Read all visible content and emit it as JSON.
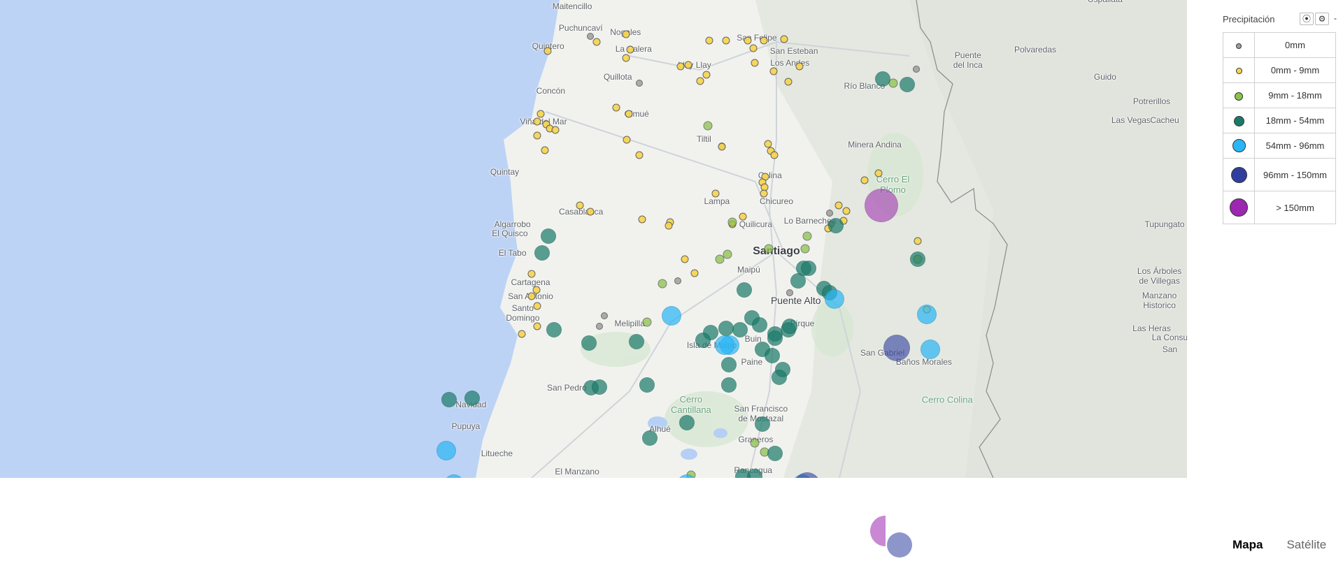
{
  "legend": {
    "title": "Precipitación",
    "controls": {
      "locate_icon": "⦿",
      "settings_icon": "⚙",
      "collapse_label": "-"
    },
    "items": [
      {
        "label": "0mm",
        "color": "#9e9e9e",
        "size": 8
      },
      {
        "label": "0mm - 9mm",
        "color": "#f7d44c",
        "size": 9
      },
      {
        "label": "9mm - 18mm",
        "color": "#8bc34a",
        "size": 12
      },
      {
        "label": "18mm - 54mm",
        "color": "#1a7a6a",
        "size": 15
      },
      {
        "label": "54mm - 96mm",
        "color": "#29b6f6",
        "size": 19
      },
      {
        "label": "96mm - 150mm",
        "color": "#303f9f",
        "size": 23
      },
      {
        "label": "> 150mm",
        "color": "#9c27b0",
        "size": 26
      }
    ]
  },
  "map_types": {
    "map_label": "Mapa",
    "satellite_label": "Satélite",
    "active": "Mapa"
  },
  "colors": {
    "ocean": "#bdd3f5",
    "land": "#f1f2ee",
    "mountains": "#e2e6de",
    "roads": "#cfd4da",
    "border": "#8a8a8a"
  },
  "places": [
    {
      "id": "maitencillo",
      "name": "Maitencillo",
      "lon": -71.439,
      "lat": -32.649
    },
    {
      "id": "puchuncavi",
      "name": "Puchuncaví",
      "lon": -71.406,
      "lat": -32.72
    },
    {
      "id": "nogales",
      "name": "Nogales",
      "lon": -71.233,
      "lat": -32.734
    },
    {
      "id": "quintero",
      "name": "Quintero",
      "lon": -71.532,
      "lat": -32.779
    },
    {
      "id": "la-calera",
      "name": "La Calera",
      "lon": -71.202,
      "lat": -32.787
    },
    {
      "id": "san-felipe",
      "name": "San Felipe",
      "lon": -70.726,
      "lat": -32.751
    },
    {
      "id": "san-esteban",
      "name": "San Esteban",
      "lon": -70.582,
      "lat": -32.795
    },
    {
      "id": "estacion-yspallata",
      "name": "Estación\nUspallata",
      "lon": -69.38,
      "lat": -32.61
    },
    {
      "id": "llay-llay",
      "name": "Llay Llay",
      "lon": -70.966,
      "lat": -32.84
    },
    {
      "id": "los-andes",
      "name": "Los Andes",
      "lon": -70.598,
      "lat": -32.833
    },
    {
      "id": "puente-del-inca",
      "name": "Puente\ndel Inca",
      "lon": -69.91,
      "lat": -32.825
    },
    {
      "id": "polvaredas",
      "name": "Polvaredas",
      "lon": -69.65,
      "lat": -32.79
    },
    {
      "id": "quillota",
      "name": "Quillota",
      "lon": -71.263,
      "lat": -32.88
    },
    {
      "id": "guido",
      "name": "Guido",
      "lon": -69.38,
      "lat": -32.88
    },
    {
      "id": "rio-blanco",
      "name": "Río Blanco",
      "lon": -70.31,
      "lat": -32.91
    },
    {
      "id": "concon",
      "name": "Concón",
      "lon": -71.522,
      "lat": -32.926
    },
    {
      "id": "potrerillos",
      "name": "Potrerillos",
      "lon": -69.2,
      "lat": -32.96
    },
    {
      "id": "vina-del-mar",
      "name": "Viña del Mar",
      "lon": -71.55,
      "lat": -33.025
    },
    {
      "id": "olmue",
      "name": "Olmué",
      "lon": -71.19,
      "lat": -33.0
    },
    {
      "id": "las-vegas",
      "name": "Las Vegas",
      "lon": -69.28,
      "lat": -33.02
    },
    {
      "id": "cacheu",
      "name": "Cacheu",
      "lon": -69.15,
      "lat": -33.02
    },
    {
      "id": "tiltil",
      "name": "Tiltil",
      "lon": -70.93,
      "lat": -33.083
    },
    {
      "id": "minera-andina",
      "name": "Minera Andina",
      "lon": -70.27,
      "lat": -33.1
    },
    {
      "id": "quintay",
      "name": "Quintay",
      "lon": -71.7,
      "lat": -33.19
    },
    {
      "id": "cerro-el-plomo",
      "name": "Cerro El\nPlomo",
      "lon": -70.2,
      "lat": -33.23,
      "kind": "green"
    },
    {
      "id": "colina",
      "name": "Colina",
      "lon": -70.675,
      "lat": -33.2
    },
    {
      "id": "lampa",
      "name": "Lampa",
      "lon": -70.88,
      "lat": -33.285
    },
    {
      "id": "chicureo",
      "name": "Chicureo",
      "lon": -70.65,
      "lat": -33.285
    },
    {
      "id": "casablanca",
      "name": "Casablanca",
      "lon": -71.405,
      "lat": -33.32
    },
    {
      "id": "quilicura",
      "name": "Quilicura",
      "lon": -70.73,
      "lat": -33.36
    },
    {
      "id": "lo-barnechea",
      "name": "Lo Barnechea",
      "lon": -70.52,
      "lat": -33.35
    },
    {
      "id": "algarrobo",
      "name": "Algarrobo",
      "lon": -71.67,
      "lat": -33.36
    },
    {
      "id": "el-quisco",
      "name": "El Quisco",
      "lon": -71.68,
      "lat": -33.39
    },
    {
      "id": "tupungato",
      "name": "Tupungato",
      "lon": -69.15,
      "lat": -33.36
    },
    {
      "id": "santiago",
      "name": "Santiago",
      "lon": -70.65,
      "lat": -33.45,
      "kind": "major"
    },
    {
      "id": "el-tabo",
      "name": "El Tabo",
      "lon": -71.67,
      "lat": -33.455
    },
    {
      "id": "maipu",
      "name": "Maipú",
      "lon": -70.757,
      "lat": -33.51
    },
    {
      "id": "los-arboles-villegas",
      "name": "Los Árboles\nde Villegas",
      "lon": -69.17,
      "lat": -33.53
    },
    {
      "id": "cartagena",
      "name": "Cartagena",
      "lon": -71.6,
      "lat": -33.55
    },
    {
      "id": "san-antonio",
      "name": "San Antonio",
      "lon": -71.6,
      "lat": -33.595
    },
    {
      "id": "puente-alto",
      "name": "Puente Alto",
      "lon": -70.575,
      "lat": -33.61,
      "kind": "mid"
    },
    {
      "id": "manzano-historico",
      "name": "Manzano\nHistorico",
      "lon": -69.17,
      "lat": -33.61
    },
    {
      "id": "santo-domingo",
      "name": "Santo\nDomingo",
      "lon": -71.63,
      "lat": -33.65
    },
    {
      "id": "melipilla",
      "name": "Melipilla",
      "lon": -71.217,
      "lat": -33.685
    },
    {
      "id": "pirque",
      "name": "Pirque",
      "lon": -70.55,
      "lat": -33.685
    },
    {
      "id": "las-heras",
      "name": "Las Heras",
      "lon": -69.2,
      "lat": -33.7
    },
    {
      "id": "la-consulta",
      "name": "La Consu",
      "lon": -69.13,
      "lat": -33.73
    },
    {
      "id": "buin",
      "name": "Buin",
      "lon": -70.74,
      "lat": -33.735
    },
    {
      "id": "isla-de-maipo",
      "name": "Isla de Maipo",
      "lon": -70.9,
      "lat": -33.755
    },
    {
      "id": "san-carlos",
      "name": "San",
      "lon": -69.13,
      "lat": -33.77
    },
    {
      "id": "san-gabriel",
      "name": "San Gabriel",
      "lon": -70.24,
      "lat": -33.78
    },
    {
      "id": "banos-morales",
      "name": "Baños Morales",
      "lon": -70.08,
      "lat": -33.81
    },
    {
      "id": "paine",
      "name": "Paine",
      "lon": -70.745,
      "lat": -33.81
    },
    {
      "id": "san-pedro",
      "name": "San Pedro",
      "lon": -71.46,
      "lat": -33.895
    },
    {
      "id": "navidad",
      "name": "Navidad",
      "lon": -71.83,
      "lat": -33.95
    },
    {
      "id": "cerro-cantillana",
      "name": "Cerro\nCantillana",
      "lon": -70.98,
      "lat": -33.95,
      "kind": "green"
    },
    {
      "id": "cerro-colina",
      "name": "Cerro Colina",
      "lon": -69.99,
      "lat": -33.935,
      "kind": "green"
    },
    {
      "id": "san-francisco-mostazal",
      "name": "San Francisco\nde Mostazal",
      "lon": -70.71,
      "lat": -33.98
    },
    {
      "id": "pupuya",
      "name": "Pupuya",
      "lon": -71.85,
      "lat": -34.02
    },
    {
      "id": "alhue",
      "name": "Alhué",
      "lon": -71.1,
      "lat": -34.03
    },
    {
      "id": "graneros",
      "name": "Graneros",
      "lon": -70.73,
      "lat": -34.065
    },
    {
      "id": "litueche",
      "name": "Litueche",
      "lon": -71.73,
      "lat": -34.11
    },
    {
      "id": "el-manzano",
      "name": "El Manzano",
      "lon": -71.42,
      "lat": -34.17
    },
    {
      "id": "rancagua",
      "name": "Rancagua",
      "lon": -70.74,
      "lat": -34.165
    }
  ],
  "stations": [
    {
      "lon": -71.37,
      "lat": -32.747,
      "cat": 0
    },
    {
      "lon": -71.18,
      "lat": -32.9,
      "cat": 0
    },
    {
      "lon": -70.86,
      "lat": -33.105,
      "cat": 0
    },
    {
      "lon": -70.445,
      "lat": -33.325,
      "cat": 0
    },
    {
      "lon": -70.44,
      "lat": -33.36,
      "cat": 0
    },
    {
      "lon": -71.03,
      "lat": -33.545,
      "cat": 0
    },
    {
      "lon": -71.315,
      "lat": -33.66,
      "cat": 0
    },
    {
      "lon": -71.335,
      "lat": -33.695,
      "cat": 0
    },
    {
      "lon": -70.6,
      "lat": -33.585,
      "cat": 0
    },
    {
      "lon": -70.11,
      "lat": -32.855,
      "cat": 0
    },
    {
      "lon": -71.345,
      "lat": -32.765,
      "cat": 1
    },
    {
      "lon": -71.23,
      "lat": -32.74,
      "cat": 1
    },
    {
      "lon": -71.535,
      "lat": -32.795,
      "cat": 1
    },
    {
      "lon": -71.215,
      "lat": -32.79,
      "cat": 1
    },
    {
      "lon": -71.23,
      "lat": -32.818,
      "cat": 1
    },
    {
      "lon": -71.02,
      "lat": -32.845,
      "cat": 1
    },
    {
      "lon": -70.99,
      "lat": -32.84,
      "cat": 1
    },
    {
      "lon": -70.91,
      "lat": -32.76,
      "cat": 1
    },
    {
      "lon": -70.845,
      "lat": -32.76,
      "cat": 1
    },
    {
      "lon": -70.76,
      "lat": -32.76,
      "cat": 1
    },
    {
      "lon": -70.7,
      "lat": -32.76,
      "cat": 1
    },
    {
      "lon": -70.62,
      "lat": -32.755,
      "cat": 1
    },
    {
      "lon": -70.74,
      "lat": -32.785,
      "cat": 1
    },
    {
      "lon": -70.735,
      "lat": -32.833,
      "cat": 1
    },
    {
      "lon": -70.66,
      "lat": -32.86,
      "cat": 1
    },
    {
      "lon": -70.56,
      "lat": -32.845,
      "cat": 1
    },
    {
      "lon": -70.605,
      "lat": -32.895,
      "cat": 1
    },
    {
      "lon": -70.92,
      "lat": -32.872,
      "cat": 1
    },
    {
      "lon": -70.945,
      "lat": -32.893,
      "cat": 1
    },
    {
      "lon": -71.27,
      "lat": -32.98,
      "cat": 1
    },
    {
      "lon": -71.22,
      "lat": -33.0,
      "cat": 1
    },
    {
      "lon": -71.56,
      "lat": -33.0,
      "cat": 1
    },
    {
      "lon": -71.575,
      "lat": -33.025,
      "cat": 1
    },
    {
      "lon": -71.54,
      "lat": -33.035,
      "cat": 1
    },
    {
      "lon": -71.525,
      "lat": -33.048,
      "cat": 1
    },
    {
      "lon": -71.505,
      "lat": -33.053,
      "cat": 1
    },
    {
      "lon": -71.575,
      "lat": -33.07,
      "cat": 1
    },
    {
      "lon": -71.228,
      "lat": -33.085,
      "cat": 1
    },
    {
      "lon": -71.545,
      "lat": -33.118,
      "cat": 1
    },
    {
      "lon": -71.18,
      "lat": -33.135,
      "cat": 1
    },
    {
      "lon": -70.86,
      "lat": -33.107,
      "cat": 1
    },
    {
      "lon": -70.683,
      "lat": -33.098,
      "cat": 1
    },
    {
      "lon": -70.672,
      "lat": -33.122,
      "cat": 1
    },
    {
      "lon": -70.657,
      "lat": -33.135,
      "cat": 1
    },
    {
      "lon": -70.693,
      "lat": -33.205,
      "cat": 1
    },
    {
      "lon": -70.705,
      "lat": -33.225,
      "cat": 1
    },
    {
      "lon": -70.695,
      "lat": -33.24,
      "cat": 1
    },
    {
      "lon": -70.7,
      "lat": -33.26,
      "cat": 1
    },
    {
      "lon": -70.885,
      "lat": -33.26,
      "cat": 1
    },
    {
      "lon": -71.41,
      "lat": -33.3,
      "cat": 1
    },
    {
      "lon": -71.37,
      "lat": -33.32,
      "cat": 1
    },
    {
      "lon": -71.17,
      "lat": -33.345,
      "cat": 1
    },
    {
      "lon": -70.82,
      "lat": -33.36,
      "cat": 1
    },
    {
      "lon": -70.78,
      "lat": -33.335,
      "cat": 1
    },
    {
      "lon": -71.06,
      "lat": -33.355,
      "cat": 1
    },
    {
      "lon": -71.065,
      "lat": -33.365,
      "cat": 1
    },
    {
      "lon": -70.45,
      "lat": -33.375,
      "cat": 1
    },
    {
      "lon": -70.41,
      "lat": -33.3,
      "cat": 1
    },
    {
      "lon": -70.38,
      "lat": -33.318,
      "cat": 1
    },
    {
      "lon": -70.31,
      "lat": -33.216,
      "cat": 1
    },
    {
      "lon": -70.255,
      "lat": -33.195,
      "cat": 1
    },
    {
      "lon": -71.005,
      "lat": -33.475,
      "cat": 1
    },
    {
      "lon": -70.965,
      "lat": -33.52,
      "cat": 1
    },
    {
      "lon": -71.596,
      "lat": -33.523,
      "cat": 1
    },
    {
      "lon": -71.578,
      "lat": -33.575,
      "cat": 1
    },
    {
      "lon": -71.595,
      "lat": -33.595,
      "cat": 1
    },
    {
      "lon": -71.575,
      "lat": -33.628,
      "cat": 1
    },
    {
      "lon": -71.575,
      "lat": -33.695,
      "cat": 1
    },
    {
      "lon": -71.635,
      "lat": -33.72,
      "cat": 1
    },
    {
      "lon": -70.07,
      "lat": -33.64,
      "cat": 1
    },
    {
      "lon": -70.105,
      "lat": -33.415,
      "cat": 1
    },
    {
      "lon": -70.39,
      "lat": -33.35,
      "cat": 1
    },
    {
      "lon": -70.82,
      "lat": -33.355,
      "cat": 2
    },
    {
      "lon": -70.87,
      "lat": -33.475,
      "cat": 2
    },
    {
      "lon": -70.84,
      "lat": -33.46,
      "cat": 2
    },
    {
      "lon": -71.09,
      "lat": -33.555,
      "cat": 2
    },
    {
      "lon": -71.15,
      "lat": -33.68,
      "cat": 2
    },
    {
      "lon": -70.53,
      "lat": -33.4,
      "cat": 2
    },
    {
      "lon": -70.54,
      "lat": -33.44,
      "cat": 2
    },
    {
      "lon": -70.68,
      "lat": -33.44,
      "cat": 2
    },
    {
      "lon": -70.2,
      "lat": -32.9,
      "cat": 2
    },
    {
      "lon": -70.915,
      "lat": -33.04,
      "cat": 2
    },
    {
      "lon": -70.735,
      "lat": -34.075,
      "cat": 2
    },
    {
      "lon": -70.695,
      "lat": -34.105,
      "cat": 2
    },
    {
      "lon": -70.98,
      "lat": -34.18,
      "cat": 2
    },
    {
      "lon": -70.105,
      "lat": -33.475,
      "cat": 2
    },
    {
      "lon": -70.79,
      "lat": -33.705,
      "cat": 3
    },
    {
      "lon": -70.845,
      "lat": -33.7,
      "cat": 3
    },
    {
      "lon": -70.745,
      "lat": -33.667,
      "cat": 3
    },
    {
      "lon": -70.715,
      "lat": -33.69,
      "cat": 3
    },
    {
      "lon": -70.605,
      "lat": -33.705,
      "cat": 3
    },
    {
      "lon": -70.6,
      "lat": -33.695,
      "cat": 3
    },
    {
      "lon": -70.655,
      "lat": -33.72,
      "cat": 3
    },
    {
      "lon": -70.655,
      "lat": -33.733,
      "cat": 3
    },
    {
      "lon": -70.775,
      "lat": -33.575,
      "cat": 3
    },
    {
      "lon": -70.565,
      "lat": -33.545,
      "cat": 3
    },
    {
      "lon": -70.545,
      "lat": -33.505,
      "cat": 3
    },
    {
      "lon": -70.465,
      "lat": -33.57,
      "cat": 3
    },
    {
      "lon": -70.445,
      "lat": -33.585,
      "cat": 3
    },
    {
      "lon": -70.905,
      "lat": -33.715,
      "cat": 3
    },
    {
      "lon": -70.935,
      "lat": -33.74,
      "cat": 3
    },
    {
      "lon": -71.19,
      "lat": -33.745,
      "cat": 3
    },
    {
      "lon": -71.375,
      "lat": -33.75,
      "cat": 3
    },
    {
      "lon": -71.51,
      "lat": -33.705,
      "cat": 3
    },
    {
      "lon": -71.555,
      "lat": -33.455,
      "cat": 3
    },
    {
      "lon": -70.705,
      "lat": -33.77,
      "cat": 3
    },
    {
      "lon": -70.665,
      "lat": -33.79,
      "cat": 3
    },
    {
      "lon": -70.835,
      "lat": -33.82,
      "cat": 3
    },
    {
      "lon": -70.835,
      "lat": -33.885,
      "cat": 3
    },
    {
      "lon": -70.625,
      "lat": -33.835,
      "cat": 3
    },
    {
      "lon": -70.64,
      "lat": -33.86,
      "cat": 3
    },
    {
      "lon": -71.15,
      "lat": -33.885,
      "cat": 3
    },
    {
      "lon": -71.365,
      "lat": -33.895,
      "cat": 3
    },
    {
      "lon": -71.335,
      "lat": -33.893,
      "cat": 3
    },
    {
      "lon": -71.825,
      "lat": -33.93,
      "cat": 3
    },
    {
      "lon": -70.995,
      "lat": -34.01,
      "cat": 3
    },
    {
      "lon": -71.14,
      "lat": -34.06,
      "cat": 3
    },
    {
      "lon": -70.705,
      "lat": -34.015,
      "cat": 3
    },
    {
      "lon": -70.655,
      "lat": -34.11,
      "cat": 3
    },
    {
      "lon": -70.735,
      "lat": -34.185,
      "cat": 3
    },
    {
      "lon": -70.24,
      "lat": -32.885,
      "cat": 3
    },
    {
      "lon": -70.145,
      "lat": -32.905,
      "cat": 3
    },
    {
      "lon": -70.42,
      "lat": -33.365,
      "cat": 3
    },
    {
      "lon": -70.525,
      "lat": -33.505,
      "cat": 3
    },
    {
      "lon": -70.105,
      "lat": -33.475,
      "cat": 3
    },
    {
      "lon": -71.53,
      "lat": -33.4,
      "cat": 3
    },
    {
      "lon": -71.915,
      "lat": -33.935,
      "cat": 3
    },
    {
      "lon": -70.78,
      "lat": -34.185,
      "cat": 3
    },
    {
      "lon": -71.055,
      "lat": -33.66,
      "cat": 4
    },
    {
      "lon": -70.425,
      "lat": -33.605,
      "cat": 4
    },
    {
      "lon": -70.07,
      "lat": -33.655,
      "cat": 4
    },
    {
      "lon": -70.055,
      "lat": -33.77,
      "cat": 4
    },
    {
      "lon": -70.83,
      "lat": -33.755,
      "cat": 4
    },
    {
      "lon": -70.85,
      "lat": -33.755,
      "cat": 4
    },
    {
      "lon": -71.925,
      "lat": -34.1,
      "cat": 4
    },
    {
      "lon": -70.995,
      "lat": -34.21,
      "cat": 4
    },
    {
      "lon": -70.55,
      "lat": -34.21,
      "cat": 4
    },
    {
      "lon": -71.895,
      "lat": -34.21,
      "cat": 4
    },
    {
      "lon": -70.185,
      "lat": -33.765,
      "cat": 5
    },
    {
      "lon": -70.53,
      "lat": -34.215,
      "cat": 5
    },
    {
      "lon": -70.245,
      "lat": -33.3,
      "cat": 6
    }
  ],
  "overflow_bubbles": [
    {
      "cat": 6,
      "ref_lon": -70.245,
      "ref_lat": -33.3
    },
    {
      "cat": 5,
      "ref_lon": -70.185,
      "ref_lat": -33.765
    }
  ]
}
